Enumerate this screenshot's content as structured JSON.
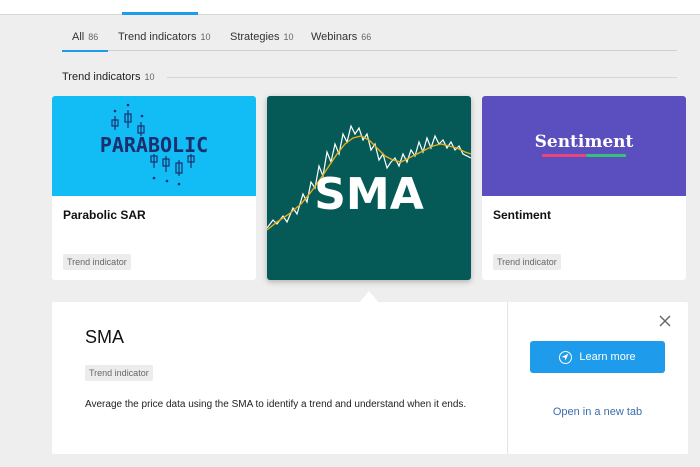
{
  "colors": {
    "accent": "#1e9bea",
    "parabolic_bg": "#12bdf5",
    "sma_bg": "#055a57",
    "sentiment_bg": "#5b4fbf"
  },
  "tabs": [
    {
      "label": "All",
      "count": "86",
      "active": true
    },
    {
      "label": "Trend indicators",
      "count": "10"
    },
    {
      "label": "Strategies",
      "count": "10"
    },
    {
      "label": "Webinars",
      "count": "66"
    }
  ],
  "section": {
    "title": "Trend indicators",
    "count": "10"
  },
  "cards": {
    "parabolic": {
      "thumb_text": "PARABOLIC",
      "title": "Parabolic SAR",
      "tag": "Trend indicator"
    },
    "sma": {
      "thumb_text": "SMA"
    },
    "sentiment": {
      "thumb_text": "Sentiment",
      "title": "Sentiment",
      "tag": "Trend indicator"
    }
  },
  "detail": {
    "title": "SMA",
    "tag": "Trend indicator",
    "description": "Average the price data using the SMA to identify a trend and understand when it ends.",
    "learn_more": "Learn more",
    "open_new_tab": "Open in a new tab"
  },
  "icons": {
    "close": "close-icon",
    "learn": "send-icon"
  }
}
